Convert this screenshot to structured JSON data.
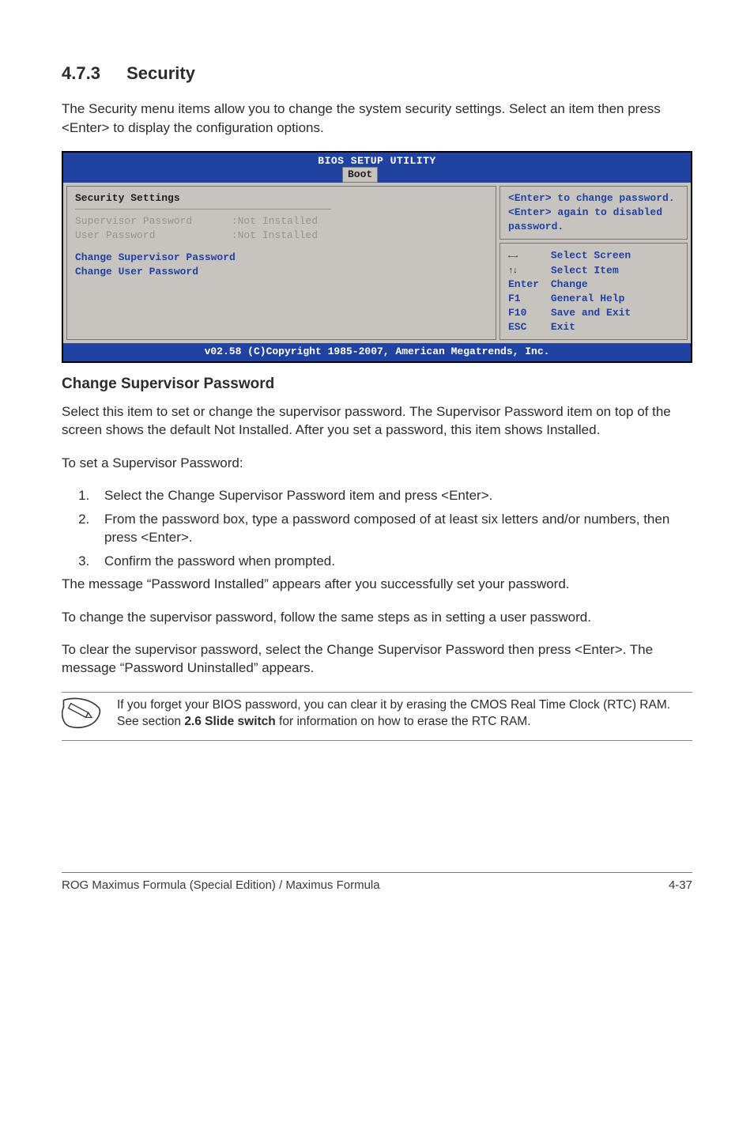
{
  "section": {
    "number": "4.7.3",
    "title": "Security"
  },
  "intro": "The Security menu items allow you to change the system security settings. Select an item then press <Enter> to display the configuration options.",
  "bios": {
    "title": "BIOS SETUP UTILITY",
    "tab": "Boot",
    "left": {
      "heading": "Security Settings",
      "rows": [
        {
          "label": "Supervisor Password",
          "value": ":Not Installed"
        },
        {
          "label": "User Password",
          "value": ":Not Installed"
        }
      ],
      "items": [
        "Change Supervisor Password",
        "Change User Password"
      ]
    },
    "right": {
      "desc": "<Enter> to change password.\n<Enter> again to disabled password.",
      "help": [
        {
          "key": "lr",
          "label": "Select Screen"
        },
        {
          "key": "ud",
          "label": "Select Item"
        },
        {
          "key": "Enter",
          "label": "Change"
        },
        {
          "key": "F1",
          "label": "General Help"
        },
        {
          "key": "F10",
          "label": "Save and Exit"
        },
        {
          "key": "ESC",
          "label": "Exit"
        }
      ]
    },
    "footer": "v02.58 (C)Copyright 1985-2007, American Megatrends, Inc."
  },
  "subheading": "Change Supervisor Password",
  "para1": "Select this item to set or change the supervisor password. The Supervisor Password item on top of the screen shows the default Not Installed. After you set a password, this item shows Installed.",
  "para2": "To set a Supervisor Password:",
  "steps": [
    "Select the Change Supervisor Password item and press <Enter>.",
    "From the password box, type a password composed of at least six letters and/or numbers, then press <Enter>.",
    "Confirm the password when prompted."
  ],
  "para3": "The message “Password Installed” appears after you successfully set your password.",
  "para4": "To change the supervisor password, follow the same steps as in setting a user password.",
  "para5": "To clear the supervisor password, select the Change Supervisor Password then press <Enter>. The message “Password Uninstalled” appears.",
  "note": {
    "pre": "If you forget your BIOS password, you can clear it by erasing the CMOS Real Time Clock (RTC) RAM. See section ",
    "bold": "2.6 Slide switch",
    "post": " for information on how to erase the RTC RAM."
  },
  "footer": {
    "left": "ROG Maximus Formula (Special Edition) / Maximus Formula",
    "right": "4-37"
  }
}
